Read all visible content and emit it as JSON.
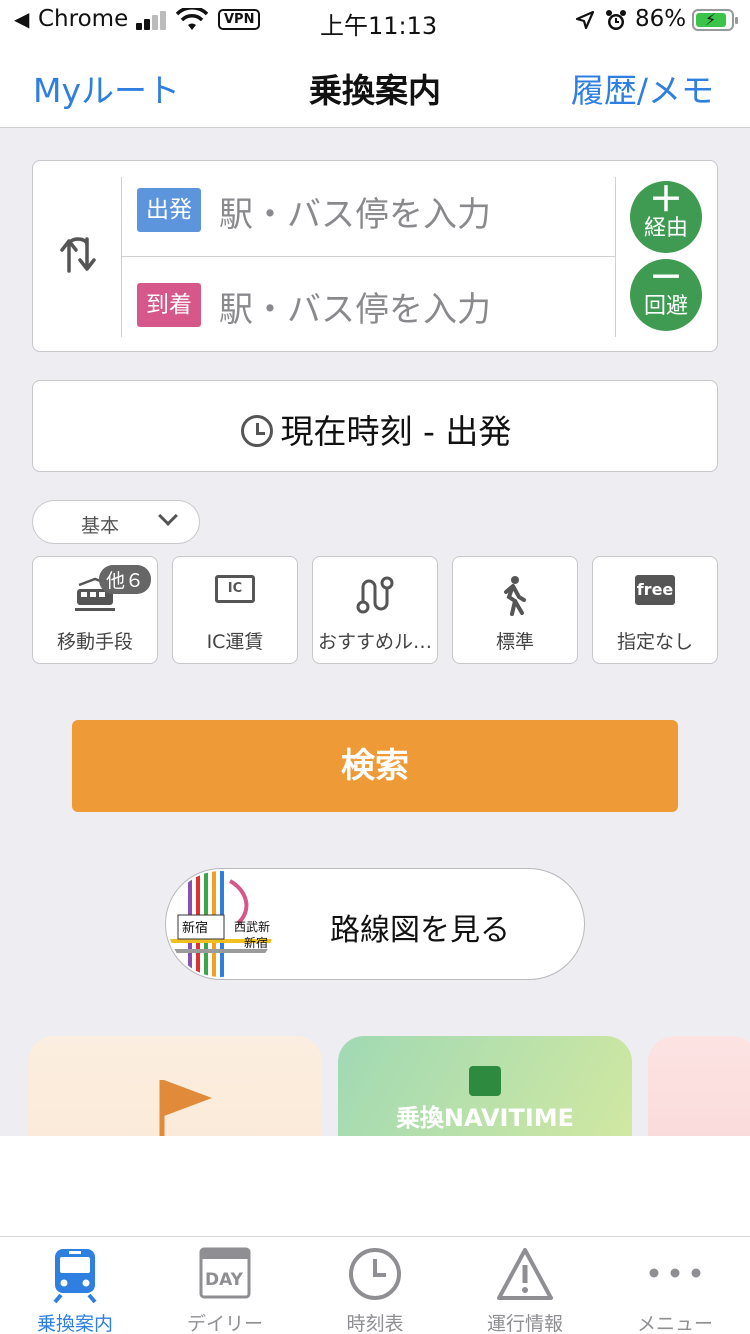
{
  "status_bar": {
    "back_app": "Chrome",
    "vpn": "VPN",
    "time": "上午11:13",
    "battery": "86%"
  },
  "nav": {
    "left": "Myルート",
    "title": "乗換案内",
    "right": "履歴/メモ"
  },
  "route": {
    "departure_tag": "出発",
    "arrival_tag": "到着",
    "departure_placeholder": "駅・バス停を入力",
    "arrival_placeholder": "駅・バス停を入力",
    "via_label": "経由",
    "avoid_label": "回避"
  },
  "time_setting": "現在時刻 - 出発",
  "preset": "基本",
  "options": [
    {
      "label": "移動手段",
      "badge": "他６",
      "icon": "train-icon"
    },
    {
      "label": "IC運賃",
      "icon_text": "IC",
      "icon": "ic-card-icon"
    },
    {
      "label": "おすすめル…",
      "icon": "route-icon"
    },
    {
      "label": "標準",
      "icon": "walk-icon"
    },
    {
      "label": "指定なし",
      "icon_text": "free",
      "icon": "free-icon"
    }
  ],
  "search_button": "検索",
  "route_map": {
    "label": "路線図を見る",
    "thumb_labels": [
      "新宿",
      "西武新",
      "新宿"
    ]
  },
  "promo": {
    "card2_title": "乗換NAVITIME"
  },
  "tabs": [
    {
      "label": "乗換案内",
      "icon": "train-icon",
      "active": true
    },
    {
      "label": "デイリー",
      "icon": "calendar-icon",
      "icon_text": "DAY",
      "active": false
    },
    {
      "label": "時刻表",
      "icon": "clock-icon",
      "active": false
    },
    {
      "label": "運行情報",
      "icon": "warning-icon",
      "active": false
    },
    {
      "label": "メニュー",
      "icon": "more-icon",
      "active": false
    }
  ],
  "colors": {
    "accent_blue": "#2f7fe0",
    "departure": "#5c95dc",
    "arrival": "#d6578a",
    "via_avoid": "#3f9b52",
    "search": "#ee9a36"
  }
}
